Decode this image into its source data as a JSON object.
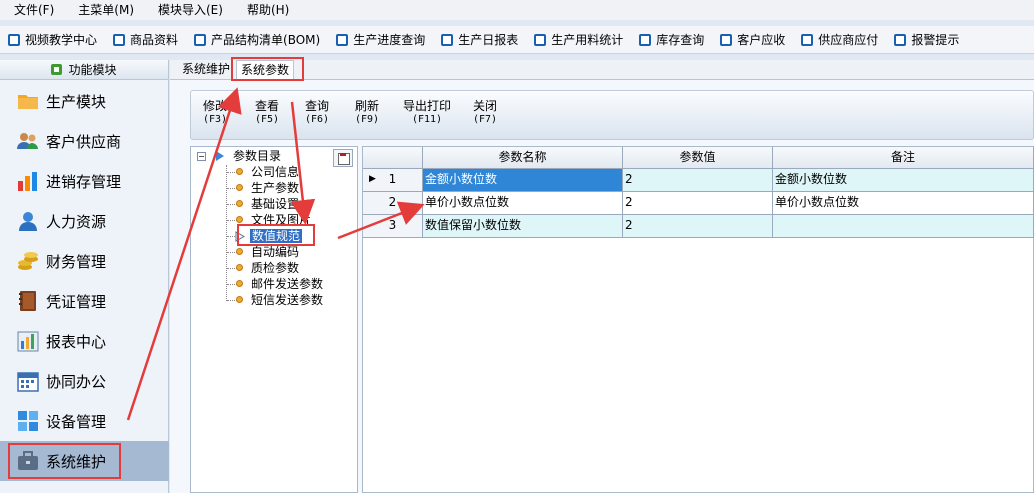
{
  "menubar": {
    "items": [
      "文件(F)",
      "主菜单(M)",
      "模块导入(E)",
      "帮助(H)"
    ]
  },
  "toolbar": {
    "items": [
      "视频教学中心",
      "商品资料",
      "产品结构清单(BOM)",
      "生产进度查询",
      "生产日报表",
      "生产用料统计",
      "库存查询",
      "客户应收",
      "供应商应付",
      "报警提示"
    ]
  },
  "sidebar": {
    "header": "功能模块",
    "items": [
      {
        "label": "生产模块",
        "icon": "folder-icon"
      },
      {
        "label": "客户供应商",
        "icon": "users-icon"
      },
      {
        "label": "进销存管理",
        "icon": "bar-chart-icon"
      },
      {
        "label": "人力资源",
        "icon": "person-icon"
      },
      {
        "label": "财务管理",
        "icon": "coins-icon"
      },
      {
        "label": "凭证管理",
        "icon": "book-icon"
      },
      {
        "label": "报表中心",
        "icon": "report-icon"
      },
      {
        "label": "协同办公",
        "icon": "calendar-icon"
      },
      {
        "label": "设备管理",
        "icon": "window-icon"
      },
      {
        "label": "系统维护",
        "icon": "briefcase-icon"
      }
    ],
    "active": "系统维护"
  },
  "tabs": [
    "系统维护",
    "系统参数"
  ],
  "actions": [
    {
      "label": "修改",
      "key": "(F3)"
    },
    {
      "label": "查看",
      "key": "(F5)"
    },
    {
      "label": "查询",
      "key": "(F6)"
    },
    {
      "label": "刷新",
      "key": "(F9)"
    },
    {
      "label": "导出打印",
      "key": "(F11)"
    },
    {
      "label": "关闭",
      "key": "(F7)"
    }
  ],
  "tree": {
    "root": "参数目录",
    "children": [
      "公司信息",
      "生产参数",
      "基础设置",
      "文件及图片",
      "数值规范",
      "自动编码",
      "质检参数",
      "邮件发送参数",
      "短信发送参数"
    ],
    "selected": "数值规范"
  },
  "grid": {
    "columns": [
      "参数名称",
      "参数值",
      "备注"
    ],
    "rows": [
      {
        "num": "1",
        "name": "金额小数位数",
        "value": "2",
        "note": "金额小数位数"
      },
      {
        "num": "2",
        "name": "单价小数点位数",
        "value": "2",
        "note": "单价小数点位数"
      },
      {
        "num": "3",
        "name": "数值保留小数位数",
        "value": "2",
        "note": ""
      }
    ]
  },
  "colors": {
    "accent": "#2f6fc5",
    "annotation": "#e43b3b",
    "active_row": "#2f86d6",
    "alt_row": "#dff6f8"
  }
}
